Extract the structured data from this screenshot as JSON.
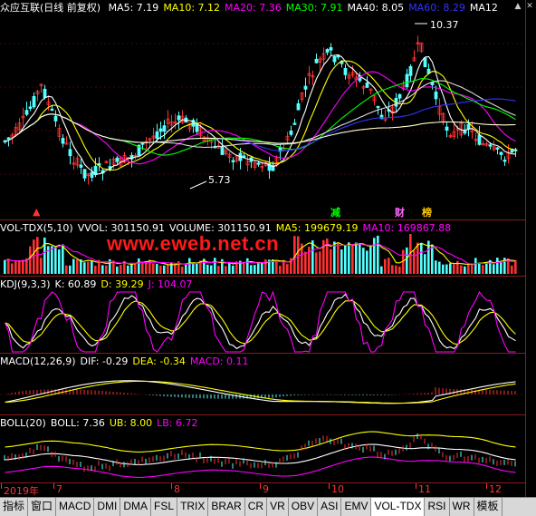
{
  "main": {
    "stock_title": "众应互联",
    "period_label": "(日线 前复权)",
    "indicators": [
      {
        "label": "MA5: 7.19",
        "color": "#ffffff"
      },
      {
        "label": "MA10: 7.12",
        "color": "#ffff00"
      },
      {
        "label": "MA20: 7.36",
        "color": "#ff00ff"
      },
      {
        "label": "MA30: 7.91",
        "color": "#00ff00"
      },
      {
        "label": "MA40: 8.05",
        "color": "#ffffff"
      },
      {
        "label": "MA60: 8.29",
        "color": "#3333ff"
      },
      {
        "label": "MA12",
        "color": "#ffffff"
      }
    ],
    "high_label": "10.37",
    "low_label": "5.73",
    "event_tags": [
      {
        "text": "减",
        "color": "#00ff00"
      },
      {
        "text": "财",
        "color": "#ff66ff"
      },
      {
        "text": "榜",
        "color": "#ffcc00"
      }
    ]
  },
  "volume": {
    "indicators": [
      {
        "label": "VOL-TDX(5,10)",
        "color": "#ffffff"
      },
      {
        "label": "VVOL: 301150.91",
        "color": "#ffffff"
      },
      {
        "label": "VOLUME: 301150.91",
        "color": "#ffffff"
      },
      {
        "label": "MA5: 199679.19",
        "color": "#ffff00"
      },
      {
        "label": "MA10: 169867.88",
        "color": "#ff00ff"
      }
    ],
    "watermark": "www.eweb.net.cn"
  },
  "kdj": {
    "indicators": [
      {
        "label": "KDJ(9,3,3)",
        "color": "#ffffff"
      },
      {
        "label": "K: 60.89",
        "color": "#ffffff"
      },
      {
        "label": "D: 39.29",
        "color": "#ffff00"
      },
      {
        "label": "J: 104.07",
        "color": "#ff00ff"
      }
    ]
  },
  "macd": {
    "indicators": [
      {
        "label": "MACD(12,26,9)",
        "color": "#ffffff"
      },
      {
        "label": "DIF: -0.29",
        "color": "#ffffff"
      },
      {
        "label": "DEA: -0.34",
        "color": "#ffff00"
      },
      {
        "label": "MACD: 0.11",
        "color": "#ff00ff"
      }
    ]
  },
  "boll": {
    "indicators": [
      {
        "label": "BOLL(20)",
        "color": "#ffffff"
      },
      {
        "label": "BOLL: 7.36",
        "color": "#ffffff"
      },
      {
        "label": "UB: 8.00",
        "color": "#ffff00"
      },
      {
        "label": "LB: 6.72",
        "color": "#ff00ff"
      }
    ]
  },
  "time_axis": {
    "labels": [
      "2019年",
      "7",
      "8",
      "9",
      "10",
      "11",
      "12"
    ]
  },
  "tabs": [
    "指标",
    "窗口",
    "MACD",
    "DMI",
    "DMA",
    "FSL",
    "TRIX",
    "BRAR",
    "CR",
    "VR",
    "OBV",
    "ASI",
    "EMV",
    "VOL-TDX",
    "RSI",
    "WR",
    "模板"
  ],
  "active_tab": "VOL-TDX",
  "colors": {
    "up": "#ff3232",
    "down": "#54ffff",
    "grid": "#8b1a1a",
    "background": "#000000"
  }
}
